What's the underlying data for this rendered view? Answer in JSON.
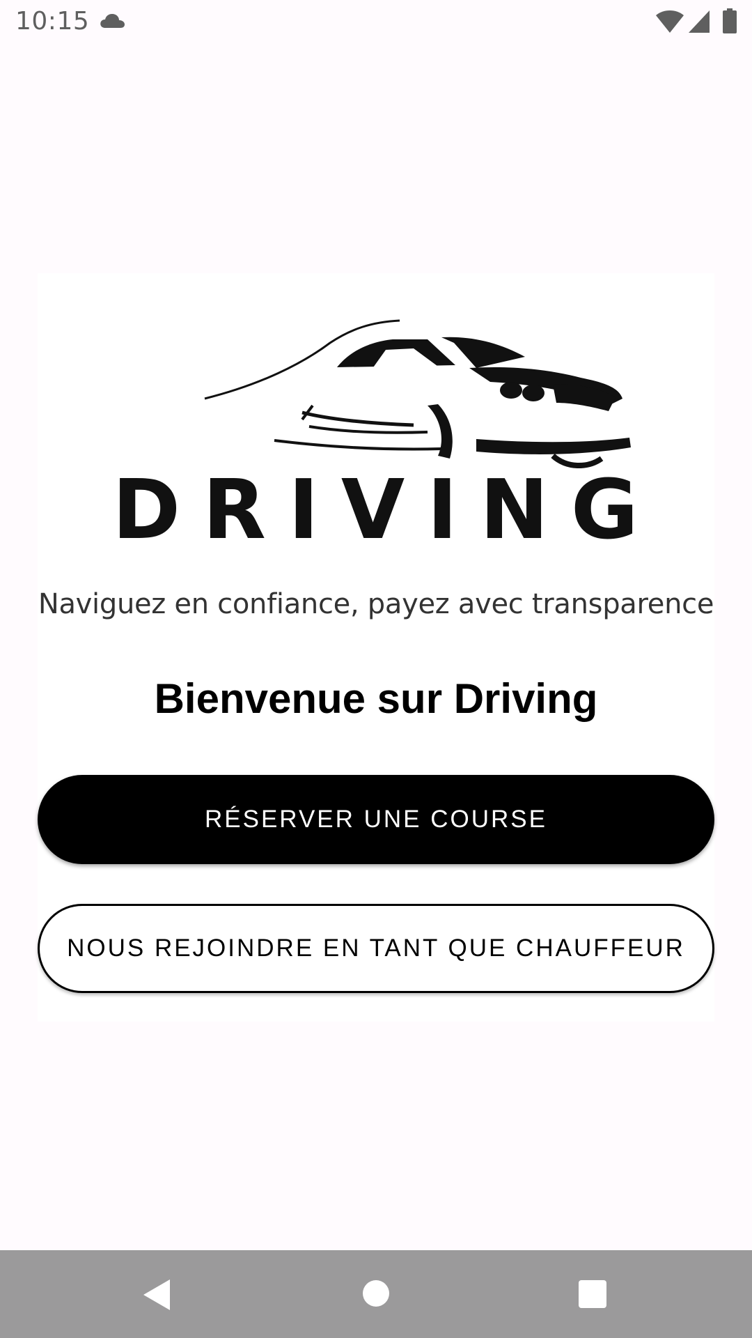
{
  "status_bar": {
    "time": "10:15",
    "icons": [
      "cloud-icon",
      "wifi-icon",
      "signal-icon",
      "battery-icon"
    ]
  },
  "logo": {
    "wordmark": "DRIVING",
    "tagline": "Naviguez en confiance, payez avec transparence",
    "icon": "car-icon"
  },
  "welcome": {
    "title": "Bienvenue sur Driving"
  },
  "buttons": {
    "book_ride": "RÉSERVER UNE COURSE",
    "join_driver": "NOUS REJOINDRE EN TANT QUE CHAUFFEUR"
  },
  "nav_bar": {
    "icons": [
      "back-icon",
      "home-icon",
      "recents-icon"
    ]
  },
  "colors": {
    "background": "#fffbfe",
    "primary_button": "#000000",
    "primary_button_text": "#ffffff",
    "nav_bar": "#9b9a9b"
  }
}
